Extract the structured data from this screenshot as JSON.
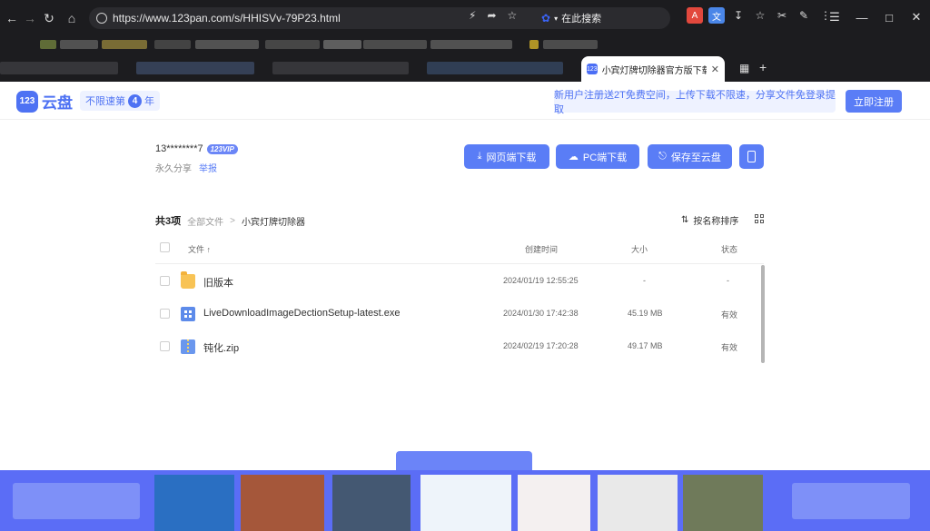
{
  "browser": {
    "url": "https://www.123pan.com/s/HHISVv-79P23.html",
    "search_label": "在此搜索",
    "tab_title": "小宾灯牌切除器官方版下载 | 来",
    "icons": [
      "back-icon",
      "forward-icon",
      "reload-icon",
      "home-icon",
      "lock-icon",
      "bolt-icon",
      "share-icon",
      "star-icon",
      "paw-icon",
      "pdf-icon",
      "translate-icon",
      "download-icon",
      "favorite-icon",
      "scissors-icon",
      "eraser-icon",
      "more-icon",
      "menu-icon",
      "minimize-icon",
      "maximize-icon",
      "close-icon"
    ]
  },
  "header": {
    "logo_badge": "123",
    "logo_text": "云盘",
    "speed_prefix": "不限速第",
    "speed_number": "4",
    "speed_suffix": "年",
    "promo": "新用户注册送2T免费空间，上传下载不限速，分享文件免登录提取",
    "register": "立即注册"
  },
  "share": {
    "user": "13********7",
    "vip_badge": "123VIP",
    "permanence": "永久分享",
    "report": "举报"
  },
  "actions": {
    "web_download": "网页端下载",
    "pc_download": "PC端下载",
    "save_to_cloud": "保存至云盘"
  },
  "listing": {
    "count": "共3项",
    "crumb_all": "全部文件",
    "crumb_sep": ">",
    "crumb_current": "小宾灯牌切除器",
    "sort_label": "按名称排序",
    "columns": {
      "name": "文件 ↑",
      "created": "创建时间",
      "size": "大小",
      "status": "状态"
    },
    "files": [
      {
        "type": "folder",
        "name": "旧版本",
        "created": "2024/01/19 12:55:25",
        "size": "-",
        "status": "-"
      },
      {
        "type": "exe",
        "name": "LiveDownloadImageDectionSetup-latest.exe",
        "created": "2024/01/30 17:42:38",
        "size": "45.19 MB",
        "status": "有效"
      },
      {
        "type": "zip",
        "name": "钝化.zip",
        "created": "2024/02/19 17:20:28",
        "size": "49.17 MB",
        "status": "有效"
      }
    ]
  },
  "colors": {
    "brand": "#5a7df6",
    "chrome": "#1c1c1f",
    "banner": "#5b6df6"
  }
}
